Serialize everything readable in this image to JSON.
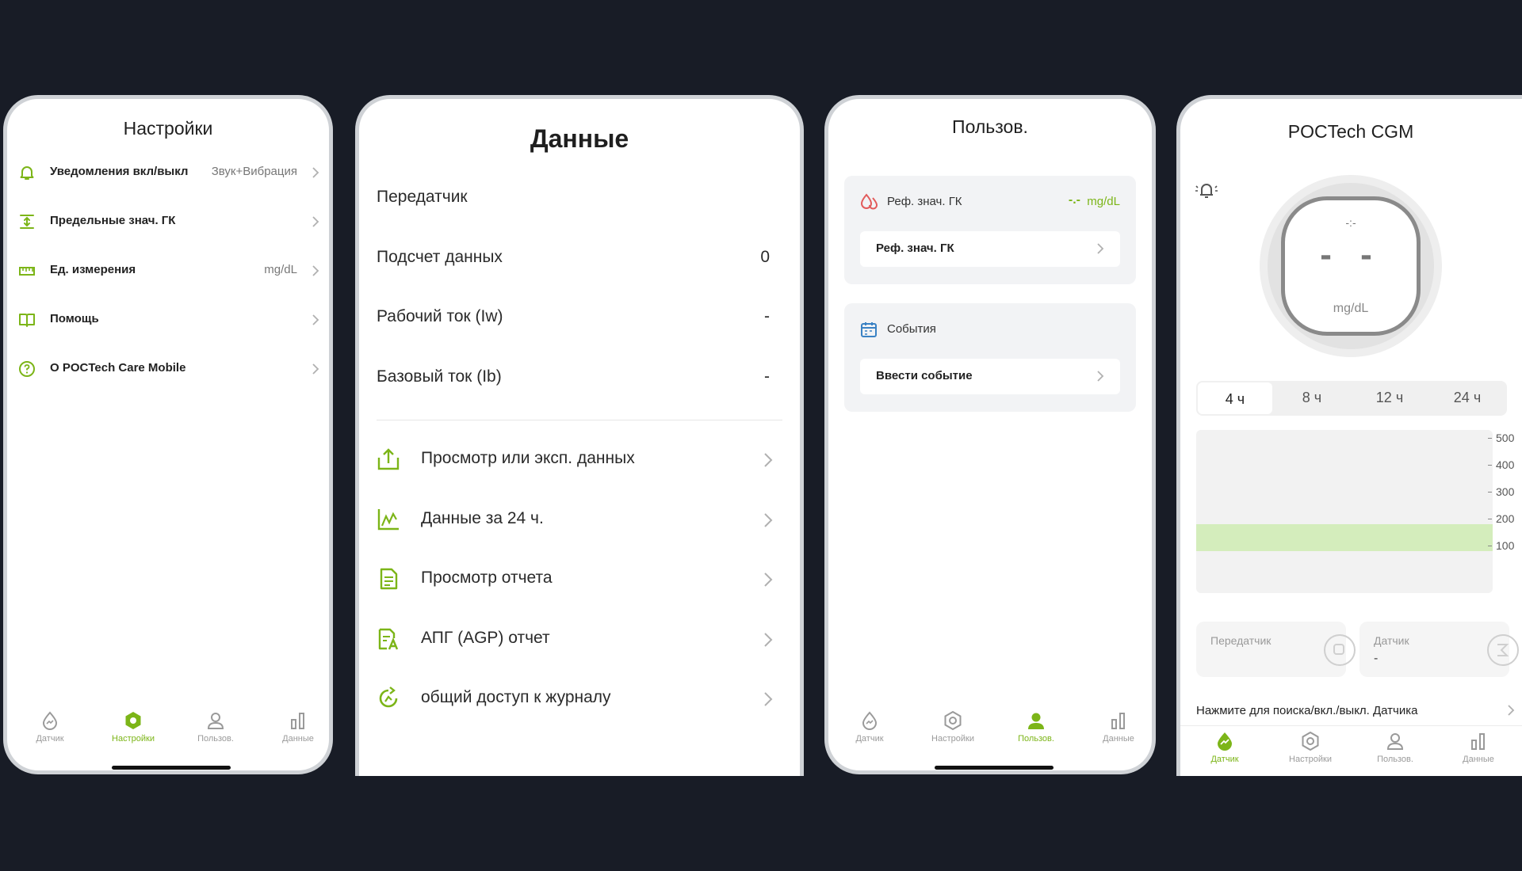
{
  "nav": {
    "sensor": "Датчик",
    "settings": "Настройки",
    "user": "Пользов.",
    "data": "Данные"
  },
  "settings_screen": {
    "title": "Настройки",
    "items": [
      {
        "label": "Уведомления вкл/выкл",
        "value": "Звук+Вибрация",
        "icon": "bell-icon"
      },
      {
        "label": "Предельные знач. ГК",
        "value": "",
        "icon": "limits-icon"
      },
      {
        "label": "Ед. измерения",
        "value": "mg/dL",
        "icon": "ruler-icon"
      },
      {
        "label": "Помощь",
        "value": "",
        "icon": "book-icon"
      },
      {
        "label": "О POCTech Care Mobile",
        "value": "",
        "icon": "question-icon"
      }
    ]
  },
  "data_screen": {
    "title": "Данные",
    "info_rows": [
      {
        "label": "Передатчик",
        "value": ""
      },
      {
        "label": "Подсчет данных",
        "value": "0"
      },
      {
        "label": "Рабочий ток (Iw)",
        "value": "-"
      },
      {
        "label": "Базовый ток (Ib)",
        "value": "-"
      }
    ],
    "menu_items": [
      {
        "label": "Просмотр или эксп. данных",
        "icon": "export-icon"
      },
      {
        "label": "Данные за 24 ч.",
        "icon": "line-chart-icon"
      },
      {
        "label": "Просмотр отчета",
        "icon": "report-icon"
      },
      {
        "label": "АПГ (AGP) отчет",
        "icon": "agp-report-icon"
      },
      {
        "label": "общий доступ к журналу",
        "icon": "share-icon"
      }
    ]
  },
  "user_screen": {
    "title": "Пользов.",
    "ref_card": {
      "header_label": "Реф. знач. ГК",
      "header_value": "-.-",
      "header_unit": "mg/dL",
      "button_label": "Реф. знач. ГК"
    },
    "events_card": {
      "header_label": "События",
      "button_label": "Ввести событие"
    }
  },
  "cgm_screen": {
    "title": "POCTech CGM",
    "gauge": {
      "time": "-:-",
      "reading": "- -",
      "unit": "mg/dL"
    },
    "ranges": [
      "4 ч",
      "8 ч",
      "12 ч",
      "24 ч"
    ],
    "active_range": "4 ч",
    "chart_data": {
      "type": "area",
      "title": "",
      "yticks": [
        500,
        400,
        300,
        200,
        100
      ],
      "target_band": [
        80,
        180
      ],
      "series": [],
      "colors": {
        "band": "#d4edbc",
        "background": "#f2f2f2"
      }
    },
    "transmitter_card": {
      "label": "Передатчик",
      "value": ""
    },
    "sensor_card": {
      "label": "Датчик",
      "value": "-"
    },
    "search_hint": "Нажмите для поиска/вкл./выкл. Датчика"
  },
  "colors": {
    "accent": "#7cb518",
    "background": "#181c26",
    "card": "#f2f3f5",
    "frame": "#cfd2d6"
  }
}
